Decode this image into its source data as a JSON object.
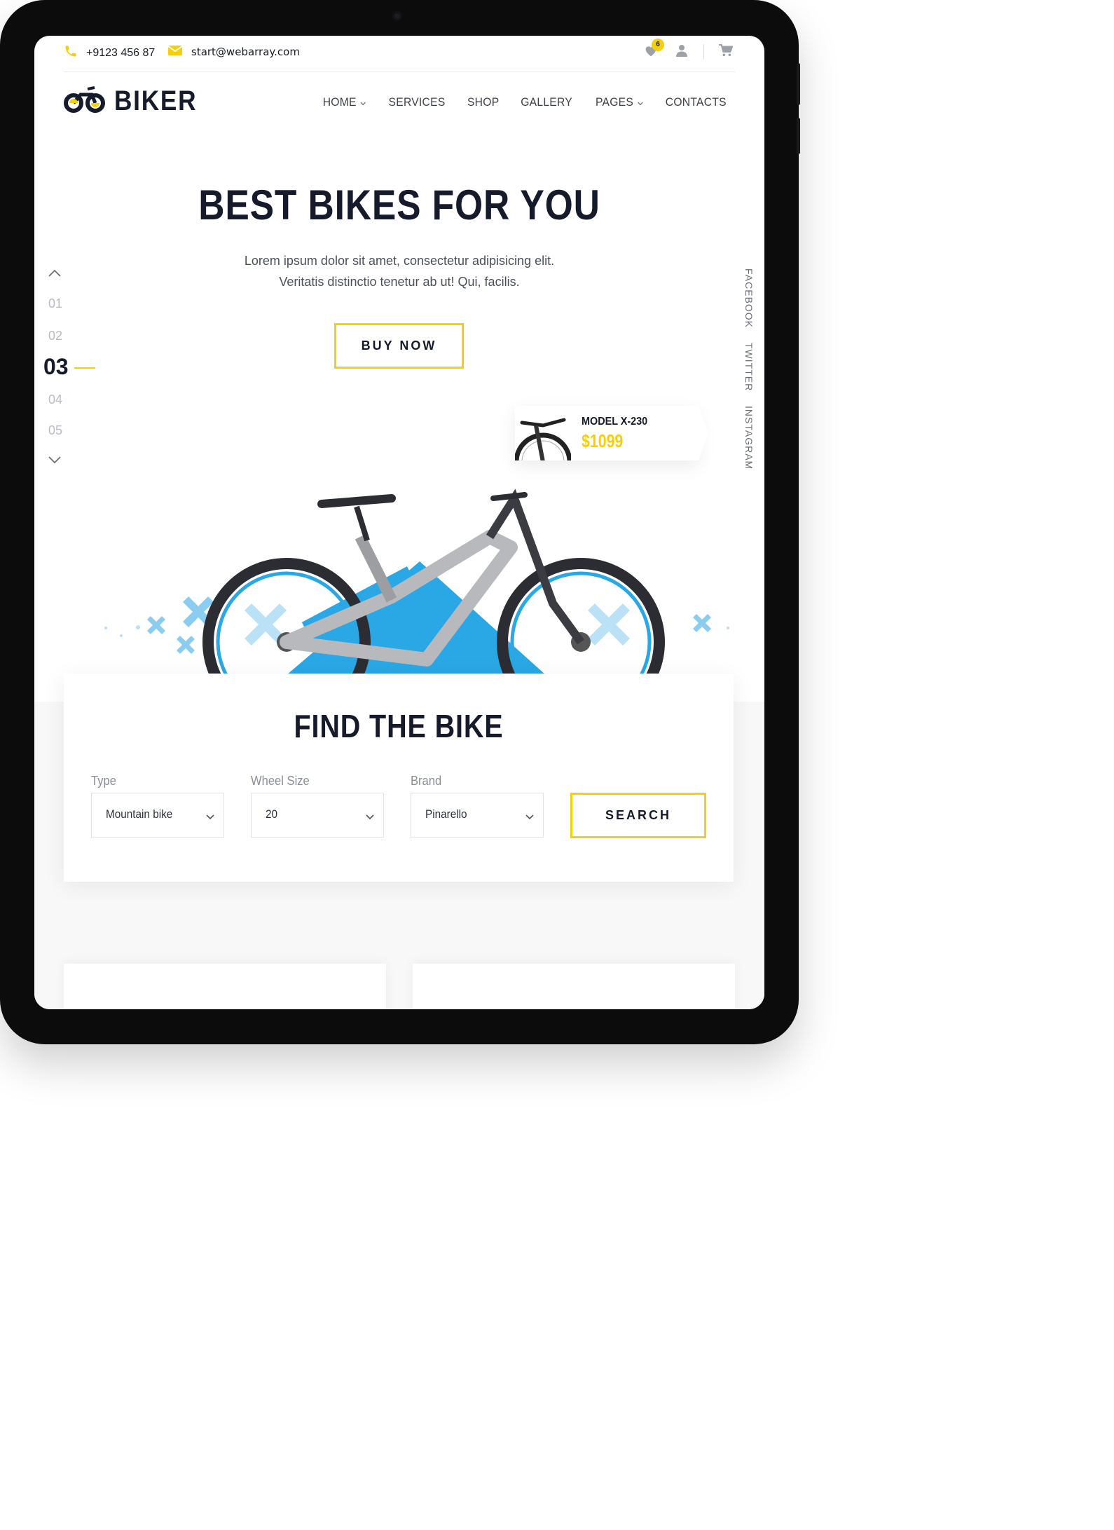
{
  "topbar": {
    "phone": "+9123 456 87",
    "email": "start@webarray.com",
    "wishlist_count": "6",
    "icons": [
      "phone-icon",
      "mail-icon",
      "heart-icon",
      "user-icon",
      "cart-icon"
    ]
  },
  "header": {
    "logo_text": "BIKER",
    "nav": [
      {
        "label": "HOME",
        "dropdown": true
      },
      {
        "label": "SERVICES",
        "dropdown": false
      },
      {
        "label": "SHOP",
        "dropdown": false
      },
      {
        "label": "GALLERY",
        "dropdown": false
      },
      {
        "label": "PAGES",
        "dropdown": true
      },
      {
        "label": "CONTACTS",
        "dropdown": false
      }
    ]
  },
  "hero": {
    "title": "BEST BIKES FOR YOU",
    "text_line1": "Lorem ipsum dolor sit amet, consectetur adipisicing elit.",
    "text_line2": "Veritatis distinctio tenetur ab ut! Qui, facilis.",
    "cta_label": "BUY NOW",
    "slides": [
      "01",
      "02",
      "03",
      "04",
      "05"
    ],
    "active_slide": "03",
    "social": [
      "FACEBOOK",
      "TWITTER",
      "INSTAGRAM"
    ],
    "model": {
      "name": "MODEL X-230",
      "price": "$1099"
    }
  },
  "find": {
    "title": "FIND THE BIKE",
    "fields": [
      {
        "label": "Type",
        "value": "Mountain bike"
      },
      {
        "label": "Wheel Size",
        "value": "20"
      },
      {
        "label": "Brand",
        "value": "Pinarello"
      }
    ],
    "search_label": "SEARCH"
  },
  "colors": {
    "accent": "#f5cf07",
    "dark": "#161b2b",
    "blue": "#29a8e5"
  }
}
